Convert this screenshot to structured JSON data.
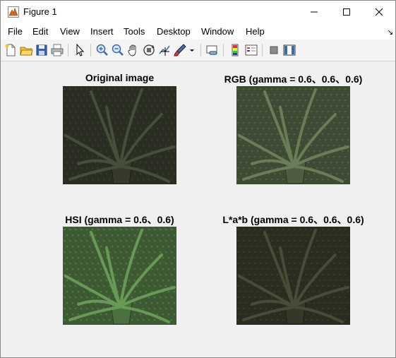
{
  "window": {
    "title": "Figure 1",
    "icon": "matlab-figure-icon",
    "controls": [
      "minimize-icon",
      "maximize-icon",
      "close-icon"
    ]
  },
  "menubar": {
    "items": [
      "File",
      "Edit",
      "View",
      "Insert",
      "Tools",
      "Desktop",
      "Window",
      "Help"
    ],
    "dock_icon": "dock-arrow-icon"
  },
  "toolbar": {
    "tools": [
      "new-figure-icon",
      "open-file-icon",
      "save-icon",
      "print-icon",
      "select-arrow-icon",
      "zoom-in-icon",
      "zoom-out-icon",
      "pan-hand-icon",
      "rotate-3d-icon",
      "data-cursor-icon",
      "brush-icon",
      "link-plot-icon",
      "insert-colorbar-icon",
      "insert-legend-icon",
      "hide-plot-tools-icon",
      "show-plot-tools-icon"
    ]
  },
  "figure": {
    "panels": [
      {
        "title": "Original image",
        "image": "aloe-plant-original",
        "tint": "#2a2e22"
      },
      {
        "title": "RGB (gamma = 0.6、0.6、0.6)",
        "image": "aloe-plant-rgb-gamma",
        "tint": "#3e4a34"
      },
      {
        "title": "HSI (gamma = 0.6、0.6)",
        "image": "aloe-plant-hsi-gamma",
        "tint": "#3d5a33"
      },
      {
        "title": "L*a*b (gamma = 0.6、0.6、0.6)",
        "image": "aloe-plant-lab-gamma",
        "tint": "#2b2c20"
      }
    ]
  },
  "colors": {
    "background": "#f0f0f0",
    "titlebar": "#ffffff",
    "leaf_green": "#3f7a4e"
  }
}
